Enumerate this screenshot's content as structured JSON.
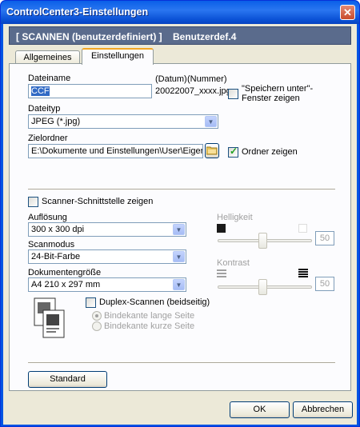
{
  "window": {
    "title": "ControlCenter3-Einstellungen"
  },
  "header": {
    "mode": "[ SCANNEN (benutzerdefiniert) ]",
    "profile": "Benutzerdef.4"
  },
  "tabs": [
    {
      "label": "Allgemeines"
    },
    {
      "label": "Einstellungen"
    }
  ],
  "file": {
    "name_label": "Dateiname",
    "name_value": "CCF",
    "date_label": "(Datum)",
    "number_label": "(Nummer)",
    "pattern": "20022007_xxxx.jpg",
    "save_as_label": "\"Speichern unter\"-Fenster zeigen",
    "type_label": "Dateityp",
    "type_value": "JPEG (*.jpg)",
    "folder_label": "Zielordner",
    "folder_value": "E:\\Dokumente und Einstellungen\\User\\Eigene Dateie",
    "show_folder_label": "Ordner zeigen"
  },
  "scanner": {
    "show_interface_label": "Scanner-Schnittstelle zeigen",
    "resolution_label": "Auflösung",
    "resolution_value": "300 x 300 dpi",
    "mode_label": "Scanmodus",
    "mode_value": "24-Bit-Farbe",
    "docsize_label": "Dokumentengröße",
    "docsize_value": "A4 210 x 297 mm",
    "brightness_label": "Helligkeit",
    "brightness_value": "50",
    "contrast_label": "Kontrast",
    "contrast_value": "50",
    "duplex_label": "Duplex-Scannen (beidseitig)",
    "long_edge_label": "Bindekante lange Seite",
    "short_edge_label": "Bindekante kurze Seite"
  },
  "buttons": {
    "default": "Standard",
    "ok": "OK",
    "cancel": "Abbrechen"
  }
}
